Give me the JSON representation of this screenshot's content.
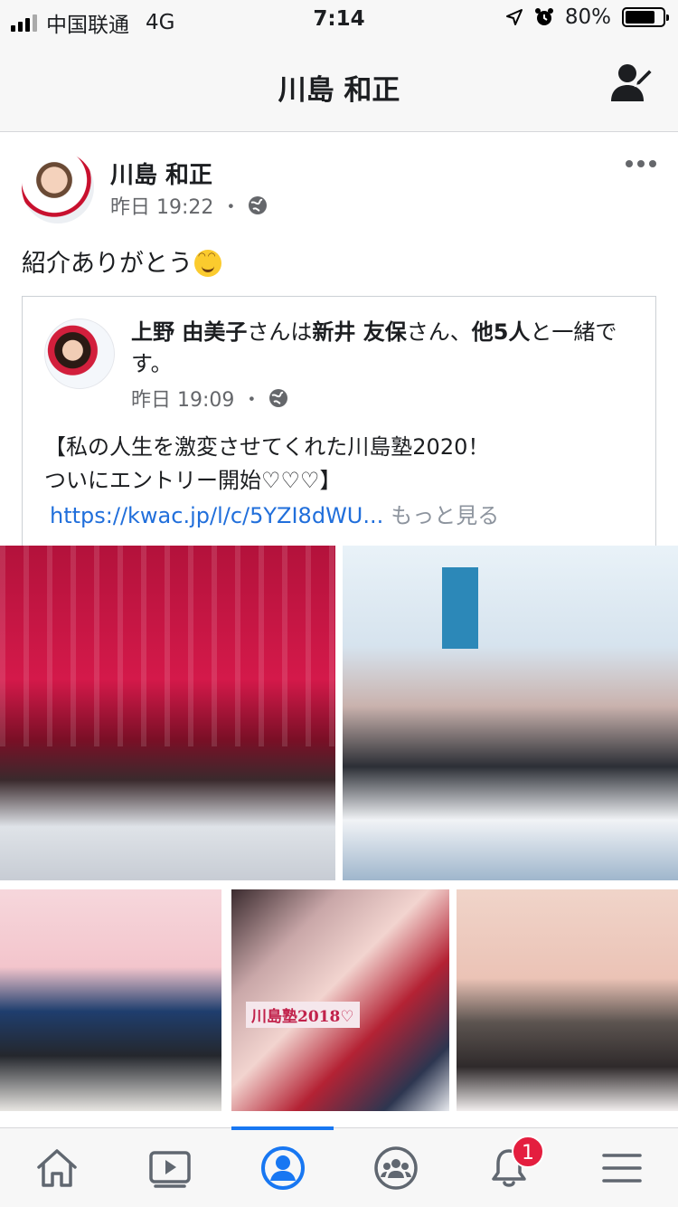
{
  "status_bar": {
    "carrier": "中国联通",
    "network": "4G",
    "time": "7:14",
    "battery": "80%",
    "battery_level": 0.8
  },
  "header": {
    "title": "川島 和正"
  },
  "post": {
    "author": "川島 和正",
    "time": "昨日 19:22",
    "separator": "・",
    "text": "紹介ありがとう",
    "shared": {
      "author": "上野 由美子",
      "with_text": "さんは",
      "friend": "新井 友保",
      "with_text2": "さん、",
      "others": "他5人",
      "suffix": "と一緒です。",
      "time": "昨日 19:09",
      "separator": "・",
      "body_line1": "【私の人生を激変させてくれた川島塾2020！",
      "body_line2": "ついにエントリー開始♡♡♡】",
      "link": "https://kwac.jp/l/c/5YZI8dWU...",
      "see_more": "もっと見る"
    },
    "photo_caption": "川島塾2018♡"
  },
  "tabs": [
    {
      "name": "home",
      "icon": "home-icon"
    },
    {
      "name": "watch",
      "icon": "video-icon"
    },
    {
      "name": "profile",
      "icon": "profile-icon",
      "active": true
    },
    {
      "name": "groups",
      "icon": "groups-icon"
    },
    {
      "name": "notifications",
      "icon": "bell-icon",
      "badge": "1"
    },
    {
      "name": "menu",
      "icon": "menu-icon"
    }
  ],
  "colors": {
    "accent": "#1877f2",
    "badge": "#e41e3f",
    "link": "#216fdb"
  }
}
